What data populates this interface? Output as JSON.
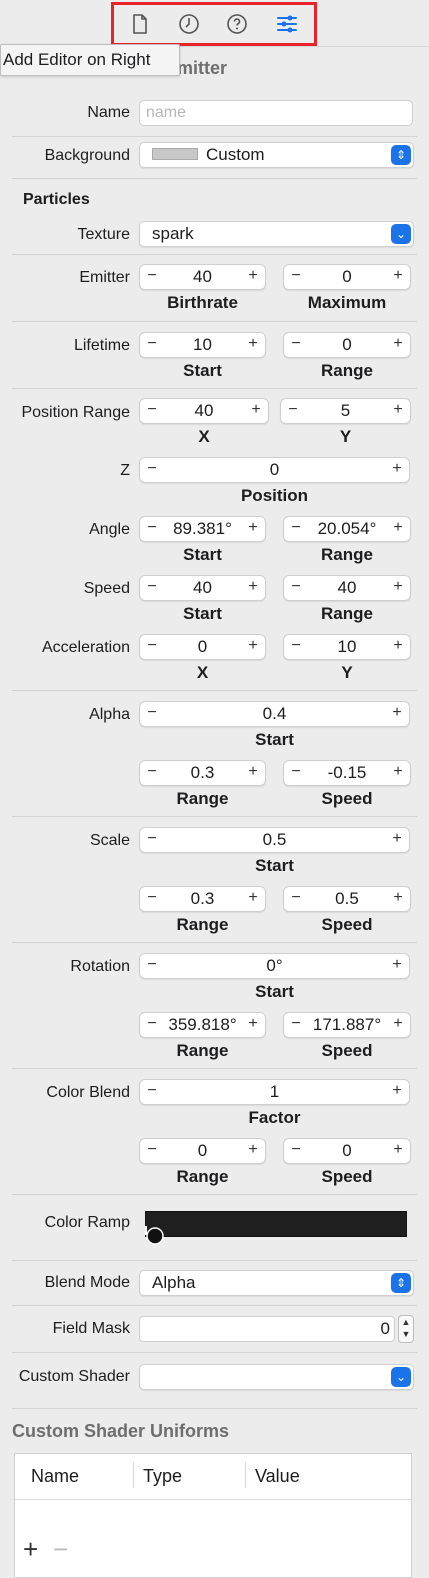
{
  "toolbar": {
    "icons": [
      "file-icon",
      "history-clock-icon",
      "help-icon",
      "attributes-sliders-icon"
    ],
    "highlight_color": "#e8232a",
    "accent_color": "#1a73e8"
  },
  "tooltip": {
    "text": "Add Editor on Right"
  },
  "section": {
    "title_visible": "e Emitter"
  },
  "name": {
    "label": "Name",
    "placeholder": "name"
  },
  "background": {
    "label": "Background",
    "value": "Custom"
  },
  "particles": {
    "header": "Particles"
  },
  "texture": {
    "label": "Texture",
    "value": "spark"
  },
  "emitter": {
    "label": "Emitter",
    "birthrate": "40",
    "maximum": "0",
    "sub_birthrate": "Birthrate",
    "sub_maximum": "Maximum"
  },
  "lifetime": {
    "label": "Lifetime",
    "start": "10",
    "range": "0",
    "sub_start": "Start",
    "sub_range": "Range"
  },
  "position_range": {
    "label": "Position Range",
    "x": "40",
    "y": "5",
    "sub_x": "X",
    "sub_y": "Y"
  },
  "z": {
    "label": "Z",
    "position": "0",
    "sub_position": "Position"
  },
  "angle": {
    "label": "Angle",
    "start": "89.381°",
    "range": "20.054°",
    "sub_start": "Start",
    "sub_range": "Range"
  },
  "speed": {
    "label": "Speed",
    "start": "40",
    "range": "40",
    "sub_start": "Start",
    "sub_range": "Range"
  },
  "acceleration": {
    "label": "Acceleration",
    "x": "0",
    "y": "10",
    "sub_x": "X",
    "sub_y": "Y"
  },
  "alpha": {
    "label": "Alpha",
    "start": "0.4",
    "range": "0.3",
    "speed": "-0.15",
    "sub_start": "Start",
    "sub_range": "Range",
    "sub_speed": "Speed"
  },
  "scale": {
    "label": "Scale",
    "start": "0.5",
    "range": "0.3",
    "speed": "0.5",
    "sub_start": "Start",
    "sub_range": "Range",
    "sub_speed": "Speed"
  },
  "rotation": {
    "label": "Rotation",
    "start": "0°",
    "range": "359.818°",
    "speed": "171.887°",
    "sub_start": "Start",
    "sub_range": "Range",
    "sub_speed": "Speed"
  },
  "color_blend": {
    "label": "Color Blend",
    "factor": "1",
    "range": "0",
    "speed": "0",
    "sub_factor": "Factor",
    "sub_range": "Range",
    "sub_speed": "Speed"
  },
  "color_ramp": {
    "label": "Color Ramp",
    "color": "#1f1f1f"
  },
  "blend_mode": {
    "label": "Blend Mode",
    "value": "Alpha"
  },
  "field_mask": {
    "label": "Field Mask",
    "value": "0"
  },
  "custom_shader": {
    "label": "Custom Shader",
    "value": ""
  },
  "uniforms": {
    "title": "Custom Shader Uniforms",
    "columns": [
      "Name",
      "Type",
      "Value"
    ],
    "add": "+",
    "remove": "−"
  },
  "stepper": {
    "minus": "−",
    "plus": "+"
  }
}
